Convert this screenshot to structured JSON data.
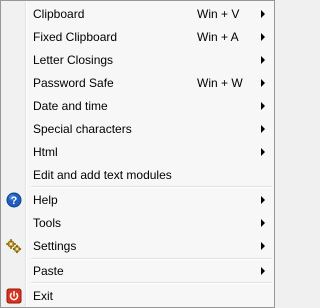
{
  "menu": {
    "items": [
      {
        "label": "Clipboard",
        "shortcut": "Win + V",
        "submenu": true
      },
      {
        "label": "Fixed Clipboard",
        "shortcut": "Win + A",
        "submenu": true
      },
      {
        "label": "Letter Closings",
        "submenu": true
      },
      {
        "label": "Password Safe",
        "shortcut": "Win + W",
        "submenu": true
      },
      {
        "label": "Date and time",
        "submenu": true
      },
      {
        "label": "Special characters",
        "submenu": true
      },
      {
        "label": "Html",
        "submenu": true
      },
      {
        "label": "Edit and add text modules",
        "submenu": false
      },
      {
        "label": "Help",
        "submenu": true,
        "icon": "help-icon"
      },
      {
        "label": "Tools",
        "submenu": true
      },
      {
        "label": "Settings",
        "submenu": true,
        "icon": "settings-gears-icon"
      },
      {
        "label": "Paste",
        "submenu": true
      },
      {
        "label": "Exit",
        "submenu": false,
        "icon": "exit-power-icon"
      }
    ]
  },
  "colors": {
    "menu_bg": "#f7f7f7",
    "gutter_bg": "#f1f1f1",
    "border": "#979797",
    "help_icon_blue": "#1f5fbf",
    "exit_icon_red": "#d9331f",
    "settings_icon_gold": "#c9a227"
  }
}
